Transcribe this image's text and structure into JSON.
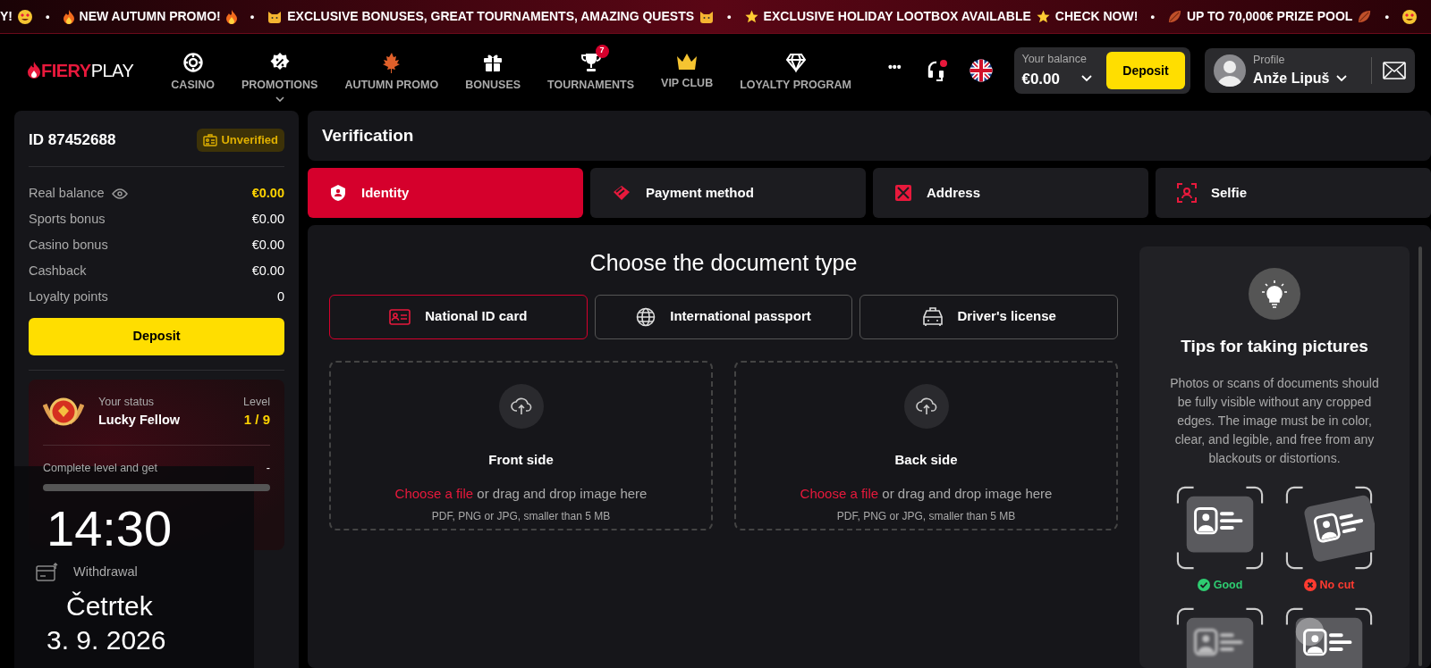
{
  "ticker": [
    {
      "kind": "text",
      "text": "Y!"
    },
    {
      "kind": "heart-eyes"
    },
    {
      "kind": "separator",
      "text": "•"
    },
    {
      "kind": "fire"
    },
    {
      "kind": "text",
      "text": "NEW AUTUMN PROMO!"
    },
    {
      "kind": "fire"
    },
    {
      "kind": "separator",
      "text": "•"
    },
    {
      "kind": "cat"
    },
    {
      "kind": "text",
      "text": "EXCLUSIVE BONUSES, GREAT TOURNAMENTS, AMAZING QUESTS"
    },
    {
      "kind": "cat"
    },
    {
      "kind": "separator",
      "text": "•"
    },
    {
      "kind": "star"
    },
    {
      "kind": "text",
      "text": "EXCLUSIVE HOLIDAY LOOTBOX AVAILABLE"
    },
    {
      "kind": "star"
    },
    {
      "kind": "text",
      "text": "CHECK NOW!"
    },
    {
      "kind": "separator",
      "text": "•"
    },
    {
      "kind": "leaf"
    },
    {
      "kind": "text",
      "text": "UP TO 70,000€ PRIZE POOL"
    },
    {
      "kind": "leaf"
    },
    {
      "kind": "separator",
      "text": "•"
    },
    {
      "kind": "heart-eyes"
    }
  ],
  "logo": {
    "part_1": "FIERY",
    "part_2": "PLAY"
  },
  "nav": [
    {
      "label": "CASINO"
    },
    {
      "label": "PROMOTIONS",
      "expandable": true
    },
    {
      "label": "AUTUMN PROMO"
    },
    {
      "label": "BONUSES"
    },
    {
      "label": "TOURNAMENTS",
      "badge": "7"
    },
    {
      "label": "VIP CLUB"
    },
    {
      "label": "LOYALTY PROGRAM"
    }
  ],
  "more": "•••",
  "balance": {
    "label": "Your balance",
    "value": "€0.00",
    "button": "Deposit"
  },
  "profile": {
    "label": "Profile",
    "name": "Anže Lipuš"
  },
  "account": {
    "id": "ID 87452688",
    "status_badge": "Unverified",
    "rows": [
      {
        "label": "Real balance",
        "value": "€0.00",
        "highlight": true,
        "toggle_visibility": true
      },
      {
        "label": "Sports bonus",
        "value": "€0.00",
        "highlight": false,
        "toggle_visibility": false
      },
      {
        "label": "Casino bonus",
        "value": "€0.00",
        "highlight": false,
        "toggle_visibility": false
      },
      {
        "label": "Cashback",
        "value": "€0.00",
        "highlight": false,
        "toggle_visibility": false
      },
      {
        "label": "Loyalty points",
        "value": "0",
        "highlight": false,
        "toggle_visibility": false
      }
    ],
    "button": "Deposit"
  },
  "status": {
    "caption": "Your status",
    "name": "Lucky Fellow",
    "level_caption": "Level",
    "level_value": "1 / 9",
    "progress_label": "Complete level and get",
    "reward": "-",
    "level": 0.0
  },
  "menu": [
    {
      "label": "Withdrawal"
    }
  ],
  "clock": {
    "time": "14:30",
    "day": "Četrtek",
    "date": "3. 9. 2026"
  },
  "verification": {
    "title": "Verification",
    "tabs": [
      {
        "label": "Identity",
        "selected": true
      },
      {
        "label": "Payment method",
        "selected": false
      },
      {
        "label": "Address",
        "selected": false
      },
      {
        "label": "Selfie",
        "selected": false
      }
    ],
    "heading": "Choose the document type",
    "doc_types": [
      {
        "label": "National ID card",
        "selected": true
      },
      {
        "label": "International passport",
        "selected": false
      },
      {
        "label": "Driver's license",
        "selected": false
      }
    ],
    "uploads": [
      {
        "title": "Front side",
        "link": "Choose a file",
        "text": " or drag and drop image here",
        "hint": "PDF, PNG or JPG, smaller than 5 MB"
      },
      {
        "title": "Back side",
        "link": "Choose a file",
        "text": " or drag and drop image here",
        "hint": "PDF, PNG or JPG, smaller than 5 MB"
      }
    ],
    "tips": {
      "title": "Tips for taking pictures",
      "text": "Photos or scans of documents should be fully visible without any cropped edges. The image must be in color, clear, and legible, and free from any blackouts or distortions.",
      "examples": [
        {
          "kind": "straight",
          "label": "Good",
          "color": "#2ecc71",
          "acceptable": true
        },
        {
          "kind": "tilted",
          "label": "No cut",
          "color": "#ff3b30",
          "acceptable": false
        },
        {
          "kind": "blurry"
        },
        {
          "kind": "glare"
        }
      ]
    }
  }
}
